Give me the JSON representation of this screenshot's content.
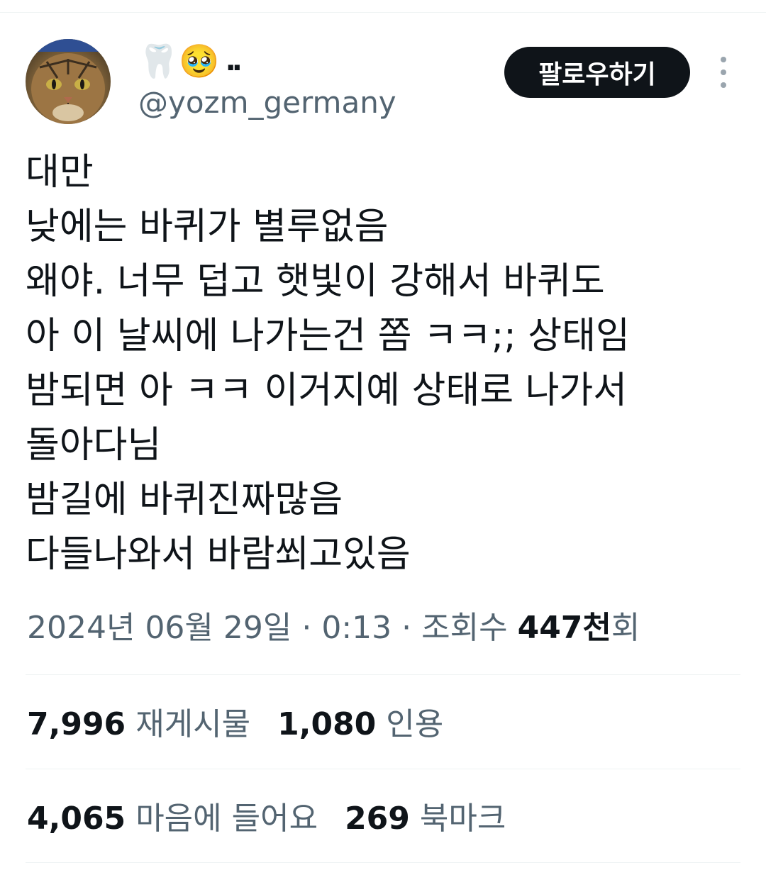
{
  "user": {
    "display_name_emojis": "🦷🥹",
    "display_name_suffix": "..",
    "handle": "@yozm_germany",
    "avatar_icon": "cat-avatar"
  },
  "header": {
    "follow_label": "팔로우하기",
    "more_icon": "more-vertical-icon"
  },
  "tweet": {
    "lines": [
      "대만",
      "낮에는 바퀴가 별루없음",
      "왜야. 너무 덥고 햇빛이 강해서 바퀴도",
      "아 이 날씨에 나가는건 쫌 ㅋㅋ;; 상태임",
      "밤되면 아 ㅋㅋ 이거지예 상태로 나가서",
      "돌아다님",
      "밤길에 바퀴진짜많음",
      "다들나와서 바람쐬고있음"
    ]
  },
  "meta": {
    "date": "2024년 06월 29일",
    "separator": " · ",
    "time": "0:13",
    "views_label": "조회수",
    "views_count": "447천",
    "views_unit": "회"
  },
  "stats": {
    "reposts_count": "7,996",
    "reposts_label": "재게시물",
    "quotes_count": "1,080",
    "quotes_label": "인용",
    "likes_count": "4,065",
    "likes_label": "마음에 들어요",
    "bookmarks_count": "269",
    "bookmarks_label": "북마크"
  },
  "colors": {
    "text_primary": "#0f1419",
    "text_secondary": "#536471",
    "divider": "#eff3f4",
    "button_bg": "#0f1419"
  }
}
